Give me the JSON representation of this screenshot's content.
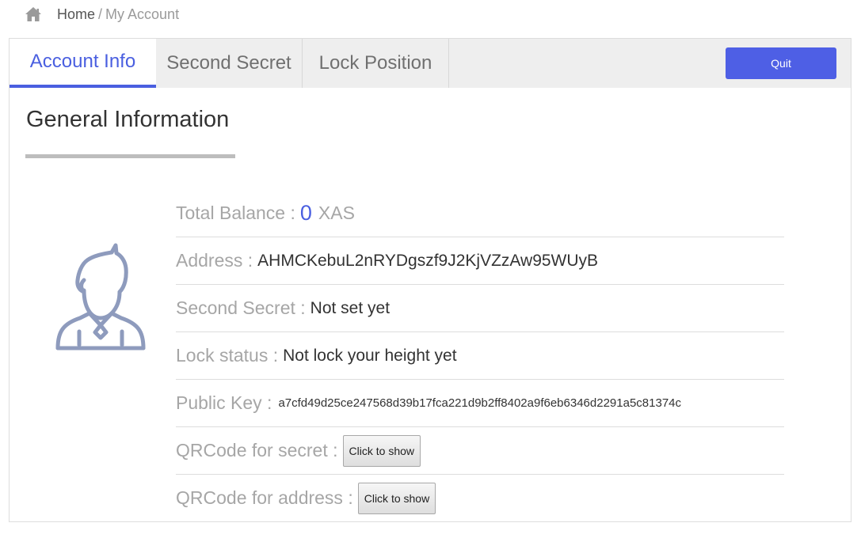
{
  "breadcrumb": {
    "home_icon": "home-icon",
    "home": "Home",
    "separator": "/",
    "current": "My Account"
  },
  "tabs": [
    {
      "label": "Account Info",
      "active": true
    },
    {
      "label": "Second Secret",
      "active": false
    },
    {
      "label": "Lock Position",
      "active": false
    }
  ],
  "quit_label": "Quit",
  "section_title": "General Information",
  "avatar_icon": "user-avatar-icon",
  "info": {
    "balance_label": "Total Balance :",
    "balance_value": "0",
    "balance_unit": "XAS",
    "address_label": "Address :",
    "address_value": "AHMCKebuL2nRYDgszf9J2KjVZzAw95WUyB",
    "second_secret_label": "Second Secret :",
    "second_secret_value": "Not set yet",
    "lock_status_label": "Lock status :",
    "lock_status_value": "Not lock your height yet",
    "public_key_label": "Public Key :",
    "public_key_value": "a7cfd49d25ce247568d39b17fca221d9b2ff8402a9f6eb6346d2291a5c81374c",
    "qr_secret_label": "QRCode for secret :",
    "qr_secret_button": "Click to show",
    "qr_address_label": "QRCode for address :",
    "qr_address_button": "Click to show"
  },
  "colors": {
    "accent": "#4a5fe0",
    "quit_button": "#4e5fe5",
    "label_gray": "#a6a6a6",
    "avatar": "#8e9bbd"
  }
}
